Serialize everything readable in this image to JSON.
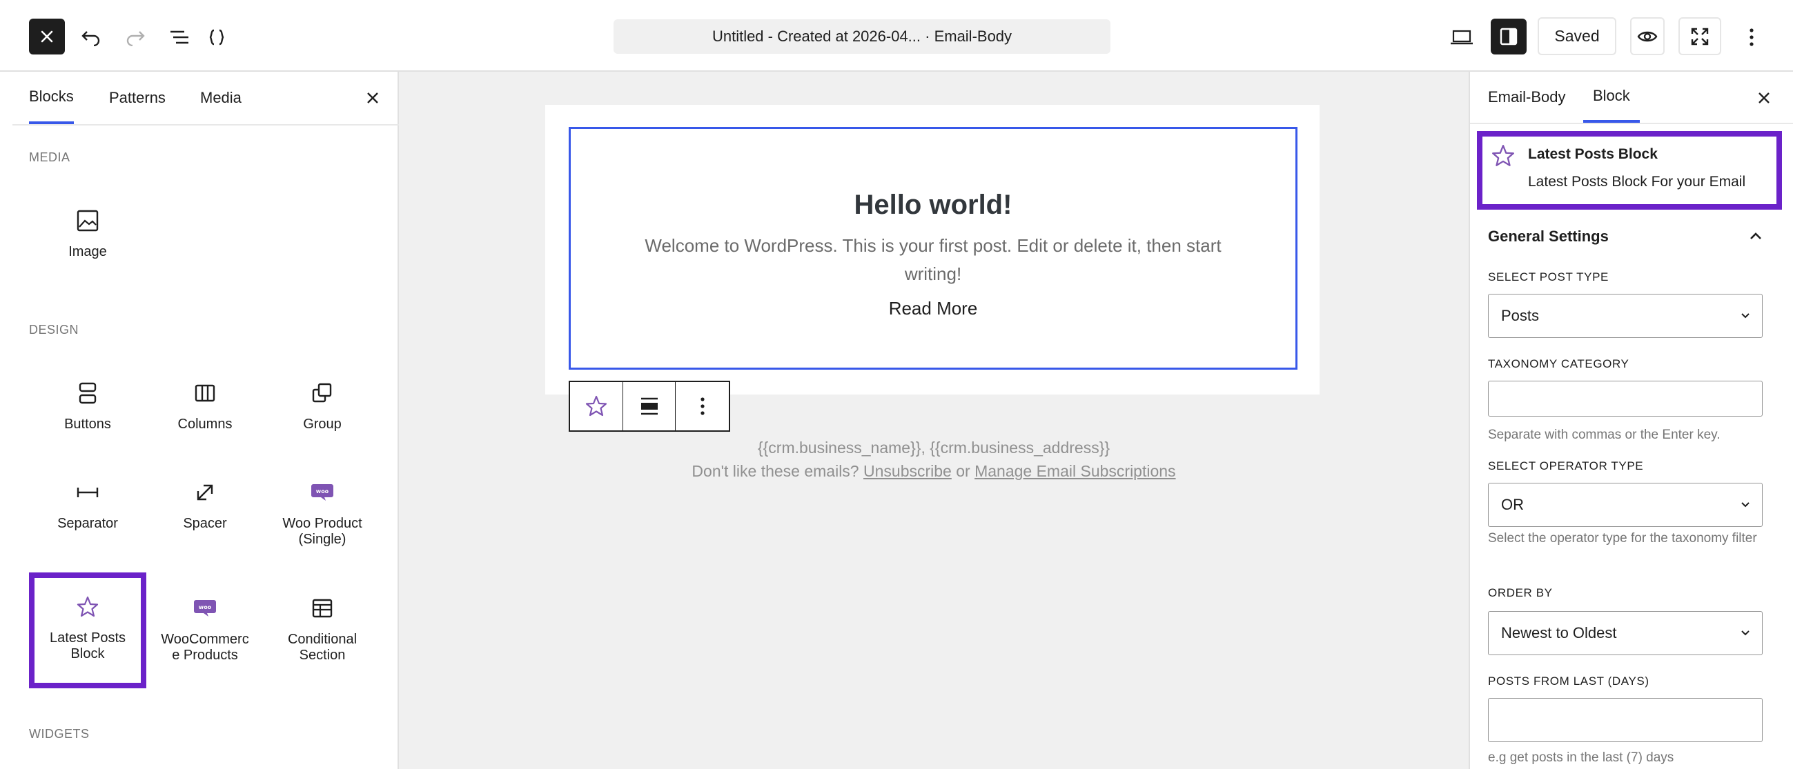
{
  "topbar": {
    "title": "Untitled - Created at 2026-04... · Email-Body",
    "saved_label": "Saved"
  },
  "inserter": {
    "tabs": [
      "Blocks",
      "Patterns",
      "Media"
    ],
    "sections": {
      "media": "MEDIA",
      "design": "DESIGN",
      "widgets": "WIDGETS"
    },
    "blocks": {
      "image": "Image",
      "buttons": "Buttons",
      "columns": "Columns",
      "group": "Group",
      "separator": "Separator",
      "spacer": "Spacer",
      "woo_product": "Woo Product (Single)",
      "latest_posts": "Latest Posts Block",
      "woo_products": "WooCommerce Products",
      "conditional": "Conditional Section"
    }
  },
  "canvas": {
    "post_title": "Hello world!",
    "post_excerpt": "Welcome to WordPress. This is your first post. Edit or delete it, then start writing!",
    "read_more": "Read More",
    "footer_address": "{{crm.business_name}}, {{crm.business_address}}",
    "footer_prefix": "Don't like these emails? ",
    "unsubscribe": "Unsubscribe",
    "or": " or ",
    "manage": "Manage Email Subscriptions"
  },
  "settings": {
    "tabs": [
      "Email-Body",
      "Block"
    ],
    "block_name": "Latest Posts Block",
    "block_desc": "Latest Posts Block For your Email",
    "panel_title": "General Settings",
    "post_type_label": "SELECT POST TYPE",
    "post_type_value": "Posts",
    "taxonomy_label": "TAXONOMY CATEGORY",
    "taxonomy_value": "",
    "taxonomy_help": "Separate with commas or the Enter key.",
    "operator_label": "SELECT OPERATOR TYPE",
    "operator_value": "OR",
    "operator_help": "Select the operator type for the taxonomy filter",
    "order_label": "ORDER BY",
    "order_value": "Newest to Oldest",
    "days_label": "POSTS FROM LAST (DAYS)",
    "days_value": "",
    "days_help": "e.g get posts in the last (7) days"
  },
  "colors": {
    "accent": "#3858e9",
    "highlight": "#6b22c9",
    "woo": "#7f54b3"
  }
}
